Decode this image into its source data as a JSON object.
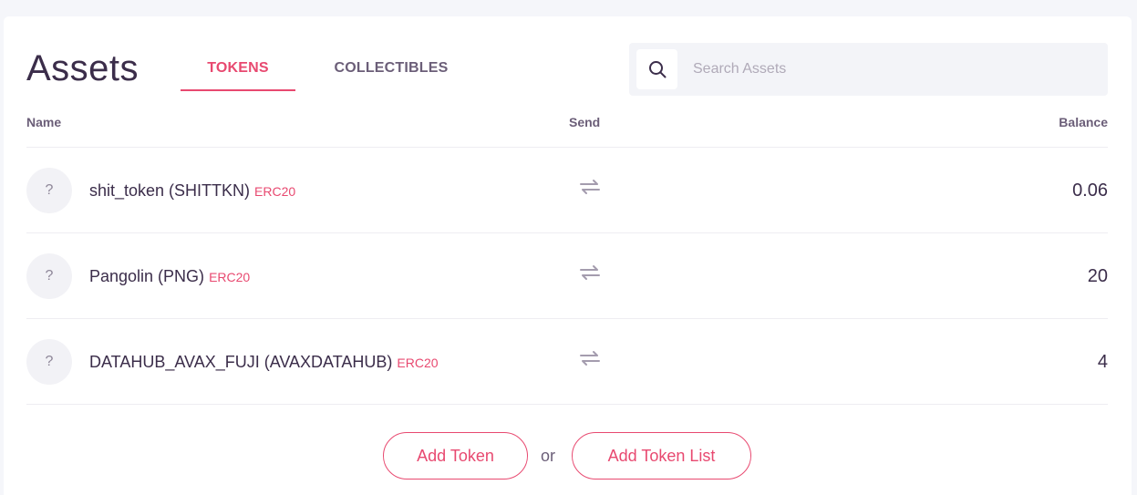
{
  "header": {
    "title": "Assets",
    "tabs": [
      {
        "label": "TOKENS",
        "active": true
      },
      {
        "label": "COLLECTIBLES",
        "active": false
      }
    ]
  },
  "search": {
    "placeholder": "Search Assets",
    "value": "",
    "icon": "search-icon"
  },
  "table": {
    "columns": [
      "Name",
      "Send",
      "Balance"
    ],
    "rows": [
      {
        "icon": "?",
        "name": "shit_token (SHITTKN)",
        "type": "ERC20",
        "send_icon": "transfer-icon",
        "balance": "0.06"
      },
      {
        "icon": "?",
        "name": "Pangolin (PNG)",
        "type": "ERC20",
        "send_icon": "transfer-icon",
        "balance": "20"
      },
      {
        "icon": "?",
        "name": "DATAHUB_AVAX_FUJI (AVAXDATAHUB)",
        "type": "ERC20",
        "send_icon": "transfer-icon",
        "balance": "4"
      }
    ]
  },
  "footer": {
    "add_token_label": "Add Token",
    "or_label": "or",
    "add_token_list_label": "Add Token List"
  },
  "colors": {
    "accent": "#e84970",
    "text": "#3b2d4a",
    "muted": "#6b5e78"
  }
}
